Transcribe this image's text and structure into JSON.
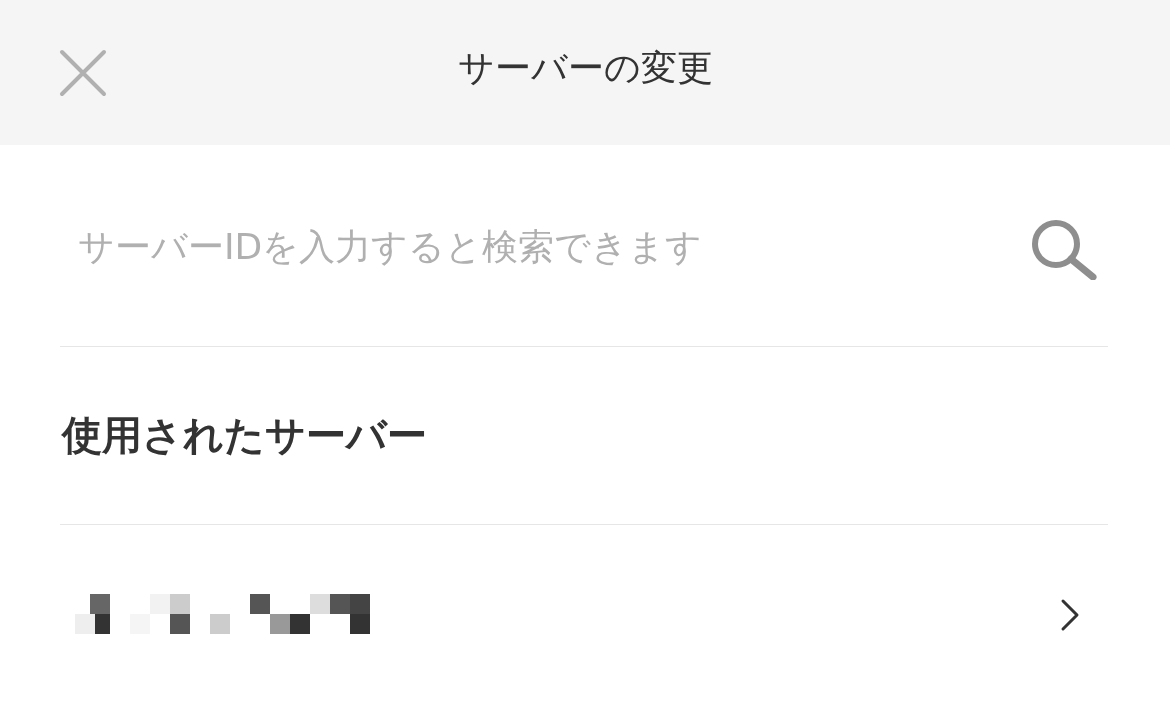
{
  "header": {
    "title": "サーバーの変更"
  },
  "search": {
    "placeholder": "サーバーIDを入力すると検索できます"
  },
  "section": {
    "title": "使用されたサーバー"
  },
  "servers": [
    {
      "kind": "pixelated"
    }
  ]
}
